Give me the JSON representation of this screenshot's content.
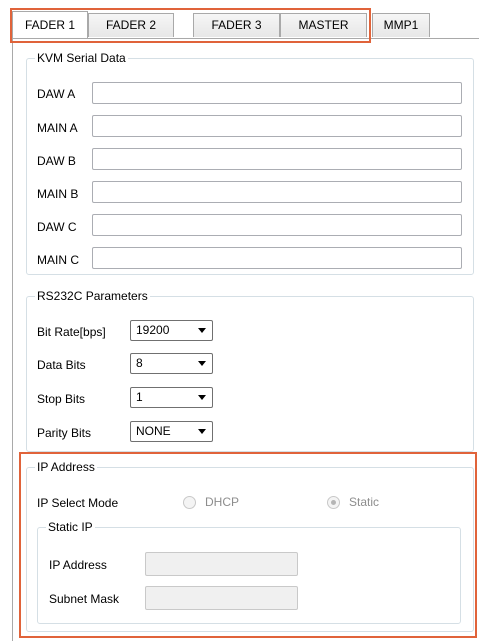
{
  "tabs": [
    {
      "label": "FADER 1",
      "active": true
    },
    {
      "label": "FADER 2",
      "active": false
    },
    {
      "label": "FADER 3",
      "active": false
    },
    {
      "label": "MASTER",
      "active": false
    },
    {
      "label": "MMP1",
      "active": false
    }
  ],
  "kvm": {
    "title": "KVM Serial Data",
    "fields": [
      {
        "label": "DAW A",
        "value": ""
      },
      {
        "label": "MAIN A",
        "value": ""
      },
      {
        "label": "DAW B",
        "value": ""
      },
      {
        "label": "MAIN B",
        "value": ""
      },
      {
        "label": "DAW C",
        "value": ""
      },
      {
        "label": "MAIN C",
        "value": ""
      }
    ]
  },
  "rs232": {
    "title": "RS232C Parameters",
    "bit_rate": {
      "label": "Bit Rate[bps]",
      "value": "19200"
    },
    "data_bits": {
      "label": "Data Bits",
      "value": "8"
    },
    "stop_bits": {
      "label": "Stop Bits",
      "value": "1"
    },
    "parity_bits": {
      "label": "Parity Bits",
      "value": "NONE"
    }
  },
  "ip": {
    "title": "IP Address",
    "select_mode_label": "IP Select Mode",
    "dhcp_label": "DHCP",
    "static_label": "Static",
    "static_ip": {
      "title": "Static IP",
      "ip_label": "IP Address",
      "ip_value": "",
      "subnet_label": "Subnet Mask",
      "subnet_value": ""
    }
  },
  "colors": {
    "highlight": "#e0633a",
    "border": "#a9a9a9",
    "group_border": "#d5dfe5"
  }
}
